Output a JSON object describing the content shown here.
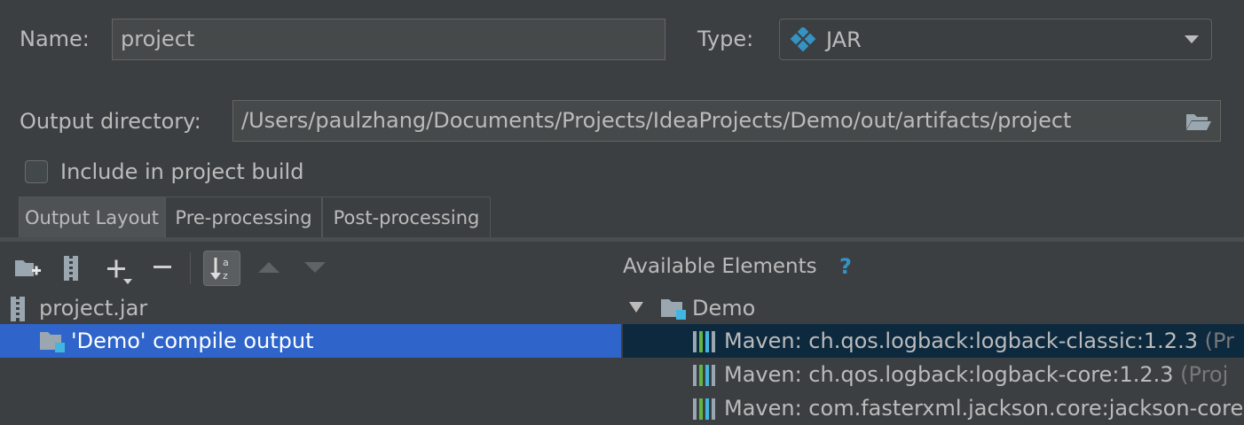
{
  "form": {
    "name_label": "Name:",
    "name_value": "project",
    "type_label": "Type:",
    "type_value": "JAR",
    "output_dir_label": "Output directory:",
    "output_dir_value": "/Users/paulzhang/Documents/Projects/IdeaProjects/Demo/out/artifacts/project",
    "include_label": "Include in project build",
    "include_checked": false
  },
  "tabs": [
    {
      "label": "Output Layout",
      "active": true
    },
    {
      "label": "Pre-processing",
      "active": false
    },
    {
      "label": "Post-processing",
      "active": false
    }
  ],
  "toolbar": {
    "icons": [
      "new-folder-icon",
      "archive-icon",
      "add-icon",
      "remove-icon",
      "sort-alphabetically-icon",
      "move-up-icon",
      "move-down-icon"
    ]
  },
  "layout_tree": {
    "root": "project.jar",
    "children": [
      "'Demo' compile output"
    ]
  },
  "available": {
    "title": "Available Elements",
    "help": "?",
    "module": "Demo",
    "items": [
      {
        "name": "Maven: ch.qos.logback:logback-classic:1.2.3",
        "suffix": "(Pr"
      },
      {
        "name": "Maven: ch.qos.logback:logback-core:1.2.3",
        "suffix": "(Proj"
      },
      {
        "name": "Maven: com.fasterxml.jackson.core:jackson-core",
        "suffix": ""
      }
    ]
  },
  "colors": {
    "background": "#3c3f41",
    "selection_focused": "#2f65ca",
    "selection_unfocused": "#0d293e",
    "accent_blue": "#3592c4"
  }
}
